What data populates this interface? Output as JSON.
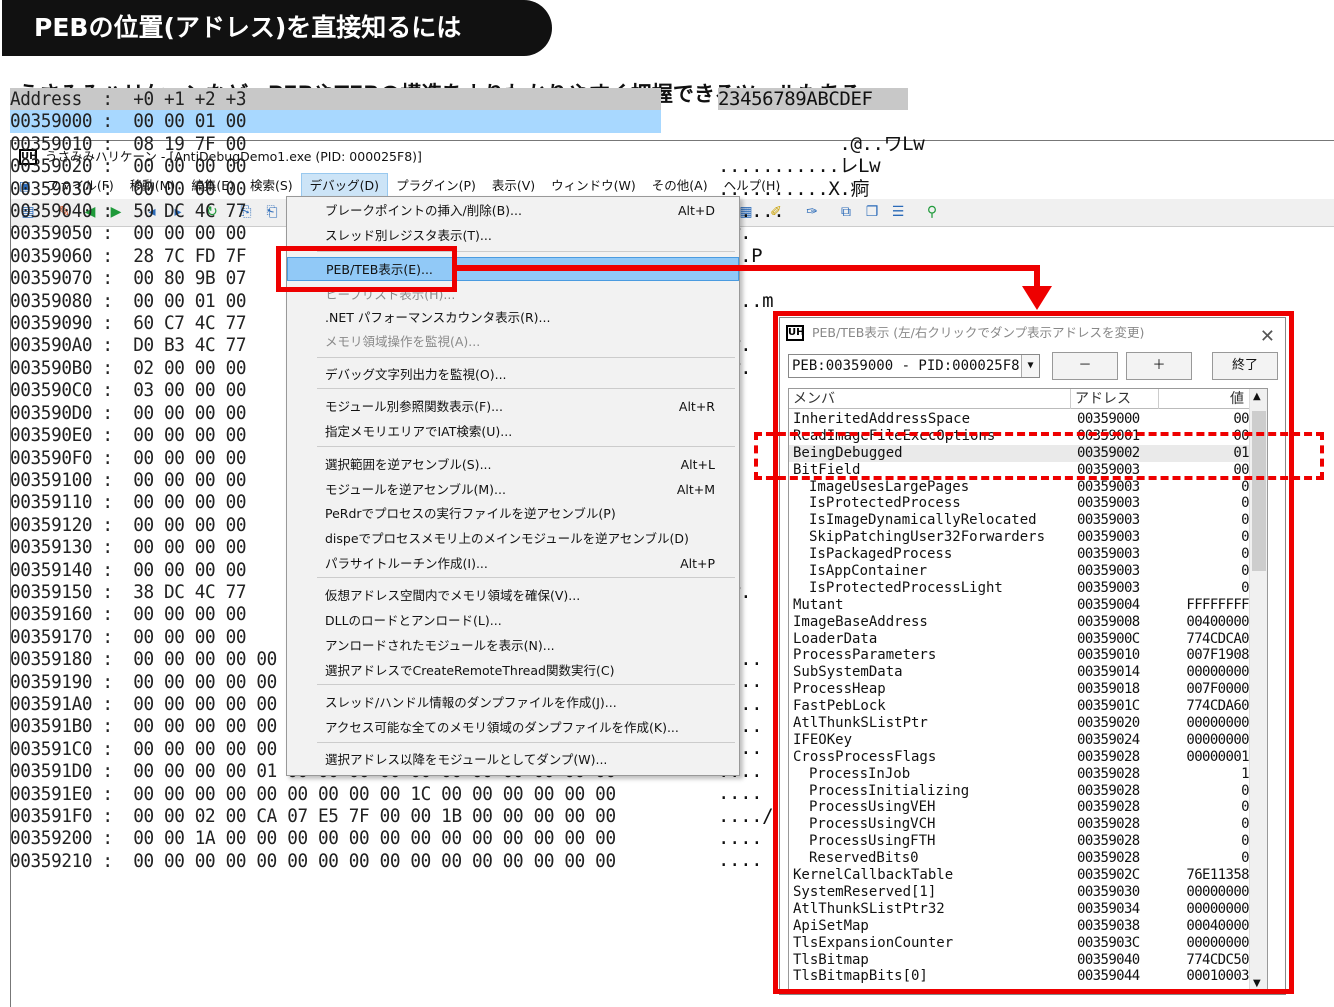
{
  "banner": {
    "title": "PEBの位置(アドレス)を直接知るには"
  },
  "subtitle": "うさみみハリケーンなど、PEBやTEBの構造をよりわかりやすく把握できるツールもある。",
  "window": {
    "icon": "UH",
    "title": "うさみみハリケーン - [AntiDebugDemo1.exe (PID: 000025F8)]",
    "menu": [
      "ファイル(F)",
      "移動(M)",
      "編集(E)",
      "検索(S)",
      "デバッグ(D)",
      "プラグイン(P)",
      "表示(V)",
      "ウィンドウ(W)",
      "その他(A)",
      "ヘルプ(H)"
    ]
  },
  "hex": {
    "header": "Address  :  +0 +1 +2 +3",
    "ascii_header": "23456789ABCDEF",
    "lines": [
      "00359000 :  00 00 01 00",
      "00359010 :  08 19 7F 00",
      "00359020 :  00 00 00 00",
      "00359030 :  00 00 00 00",
      "00359040 :  50 DC 4C 77",
      "00359050 :  00 00 00 00",
      "00359060 :  28 7C FD 7F",
      "00359070 :  00 80 9B 07",
      "00359080 :  00 00 01 00",
      "00359090 :  60 C7 4C 77",
      "003590A0 :  D0 B3 4C 77",
      "003590B0 :  02 00 00 00",
      "003590C0 :  03 00 00 00",
      "003590D0 :  00 00 00 00",
      "003590E0 :  00 00 00 00",
      "003590F0 :  00 00 00 00",
      "00359100 :  00 00 00 00",
      "00359110 :  00 00 00 00",
      "00359120 :  00 00 00 00",
      "00359130 :  00 00 00 00",
      "00359140 :  00 00 00 00",
      "00359150 :  38 DC 4C 77",
      "00359160 :  00 00 00 00",
      "00359170 :  00 00 00 00",
      "00359180 :  00 00 00 00 00 00 00 00 00 00 00 00 00 00 00 00",
      "00359190 :  00 00 00 00 00 00 00 00 00 00 00 00 00 00 00 00",
      "003591A0 :  00 00 00 00 00 00 00 00 00 00 00 00 00 00 00 00",
      "003591B0 :  00 00 00 00 00 00 00 00 00 00 00 00 00 00 00 00",
      "003591C0 :  00 00 00 00 00 00 00 00 00 00 00 00 00 00 00 00",
      "003591D0 :  00 00 00 00 01 00 00 00 00 00 00 00 00 00 00 00",
      "003591E0 :  00 00 00 00 00 00 00 00 00 1C 00 00 00 00 00 00",
      "003591F0 :  00 00 02 00 CA 07 E5 7F 00 00 1B 00 00 00 00 00",
      "00359200 :  00 00 1A 00 00 00 00 00 00 00 00 00 00 00 00 00",
      "00359210 :  00 00 00 00 00 00 00 00 00 00 00 00 00 00 00 00"
    ],
    "ascii": [
      "",
      "           .@..ワLw",
      "...........レLw",
      "..........X.痾",
      "......",
      "Lw.",
      "...P",
      "",
      "....m",
      "",
      "Lw.",
      "Lw.",
      "",
      "",
      "",
      "",
      "",
      "",
      "",
      "",
      "",
      "Lw.",
      "",
      "",
      "....",
      "....",
      "....",
      "....",
      "....",
      "....",
      "....",
      "..../",
      "....",
      "...."
    ]
  },
  "debug_menu": {
    "items": [
      {
        "label": "ブレークポイントの挿入/削除(B)...",
        "shortcut": "Alt+D"
      },
      {
        "label": "スレッド別レジスタ表示(T)...",
        "shortcut": ""
      },
      {
        "label": "PEB/TEB表示(E)...",
        "shortcut": ""
      },
      {
        "label": "ヒープリスト表示(H)...",
        "shortcut": ""
      },
      {
        "label": ".NET パフォーマンスカウンタ表示(R)...",
        "shortcut": ""
      },
      {
        "label": "メモリ領域操作を監視(A)...",
        "shortcut": ""
      },
      {
        "label": "デバッグ文字列出力を監視(O)...",
        "shortcut": ""
      },
      {
        "label": "モジュール別参照関数表示(F)...",
        "shortcut": "Alt+R"
      },
      {
        "label": "指定メモリエリアでIAT検索(U)...",
        "shortcut": ""
      },
      {
        "label": "選択範囲を逆アセンブル(S)...",
        "shortcut": "Alt+L"
      },
      {
        "label": "モジュールを逆アセンブル(M)...",
        "shortcut": "Alt+M"
      },
      {
        "label": "PeRdrでプロセスの実行ファイルを逆アセンブル(P)",
        "shortcut": ""
      },
      {
        "label": "dispeでプロセスメモリ上のメインモジュールを逆アセンブル(D)",
        "shortcut": ""
      },
      {
        "label": "パラサイトルーチン作成(I)...",
        "shortcut": "Alt+P"
      },
      {
        "label": "仮想アドレス空間内でメモリ領域を確保(V)...",
        "shortcut": ""
      },
      {
        "label": "DLLのロードとアンロード(L)...",
        "shortcut": ""
      },
      {
        "label": "アンロードされたモジュールを表示(N)...",
        "shortcut": ""
      },
      {
        "label": "選択アドレスでCreateRemoteThread関数実行(C)",
        "shortcut": ""
      },
      {
        "label": "スレッド/ハンドル情報のダンプファイルを作成(J)...",
        "shortcut": ""
      },
      {
        "label": "アクセス可能な全てのメモリ領域のダンプファイルを作成(K)...",
        "shortcut": ""
      },
      {
        "label": "選択アドレス以降をモジュールとしてダンプ(W)...",
        "shortcut": ""
      }
    ]
  },
  "peb_dialog": {
    "icon": "UH",
    "title": "PEB/TEB表示 (左/右クリックでダンプ表示アドレスを変更)",
    "combo_value": "PEB:00359000 - PID:000025F8",
    "btn_minus": "－",
    "btn_plus": "＋",
    "btn_close": "終了",
    "columns": [
      "メンバ",
      "アドレス",
      "値"
    ],
    "rows": [
      [
        "InheritedAddressSpace",
        "00359000",
        "00"
      ],
      [
        "ReadImageFileExecOptions",
        "00359001",
        "00"
      ],
      [
        "BeingDebugged",
        "00359002",
        "01"
      ],
      [
        "BitField",
        "00359003",
        "00"
      ],
      [
        "ImageUsesLargePages",
        "00359003",
        "0"
      ],
      [
        "IsProtectedProcess",
        "00359003",
        "0"
      ],
      [
        "IsImageDynamicallyRelocated",
        "00359003",
        "0"
      ],
      [
        "SkipPatchingUser32Forwarders",
        "00359003",
        "0"
      ],
      [
        "IsPackagedProcess",
        "00359003",
        "0"
      ],
      [
        "IsAppContainer",
        "00359003",
        "0"
      ],
      [
        "IsProtectedProcessLight",
        "00359003",
        "0"
      ],
      [
        "Mutant",
        "00359004",
        "FFFFFFFF"
      ],
      [
        "ImageBaseAddress",
        "00359008",
        "00400000"
      ],
      [
        "LoaderData",
        "0035900C",
        "774CDCA0"
      ],
      [
        "ProcessParameters",
        "00359010",
        "007F1908"
      ],
      [
        "SubSystemData",
        "00359014",
        "00000000"
      ],
      [
        "ProcessHeap",
        "00359018",
        "007F0000"
      ],
      [
        "FastPebLock",
        "0035901C",
        "774CDA60"
      ],
      [
        "AtlThunkSListPtr",
        "00359020",
        "00000000"
      ],
      [
        "IFEOKey",
        "00359024",
        "00000000"
      ],
      [
        "CrossProcessFlags",
        "00359028",
        "00000001"
      ],
      [
        "ProcessInJob",
        "00359028",
        "1"
      ],
      [
        "ProcessInitializing",
        "00359028",
        "0"
      ],
      [
        "ProcessUsingVEH",
        "00359028",
        "0"
      ],
      [
        "ProcessUsingVCH",
        "00359028",
        "0"
      ],
      [
        "ProcessUsingFTH",
        "00359028",
        "0"
      ],
      [
        "ReservedBits0",
        "00359028",
        "0"
      ],
      [
        "KernelCallbackTable",
        "0035902C",
        "76E11358"
      ],
      [
        "SystemReserved[1]",
        "00359030",
        "00000000"
      ],
      [
        "AtlThunkSListPtr32",
        "00359034",
        "00000000"
      ],
      [
        "ApiSetMap",
        "00359038",
        "00040000"
      ],
      [
        "TlsExpansionCounter",
        "0035903C",
        "00000000"
      ],
      [
        "TlsBitmap",
        "00359040",
        "774CDC50"
      ],
      [
        "TlsBitmapBits[0]",
        "00359044",
        "00010003"
      ]
    ]
  },
  "colors": {
    "highlight": "#e00000",
    "banner_bg": "#111111",
    "menu_hover": "#91c9f7"
  }
}
